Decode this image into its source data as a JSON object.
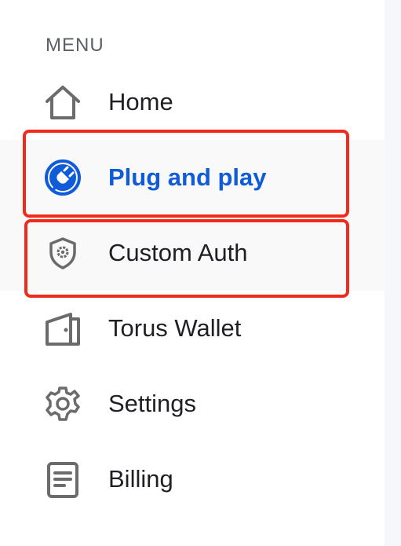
{
  "menu": {
    "heading": "MENU",
    "items": [
      {
        "label": "Home",
        "icon": "home-icon"
      },
      {
        "label": "Plug and play",
        "icon": "plug-icon",
        "active": true
      },
      {
        "label": "Custom Auth",
        "icon": "shield-gear-icon"
      },
      {
        "label": "Torus Wallet",
        "icon": "wallet-icon"
      },
      {
        "label": "Settings",
        "icon": "gear-icon"
      },
      {
        "label": "Billing",
        "icon": "document-icon"
      }
    ]
  },
  "colors": {
    "active": "#0f5bd8",
    "text": "#1f2024",
    "icon": "#6b6b6b",
    "highlight_border": "#ef2b1d",
    "shaded_row": "#f9f9fa"
  }
}
